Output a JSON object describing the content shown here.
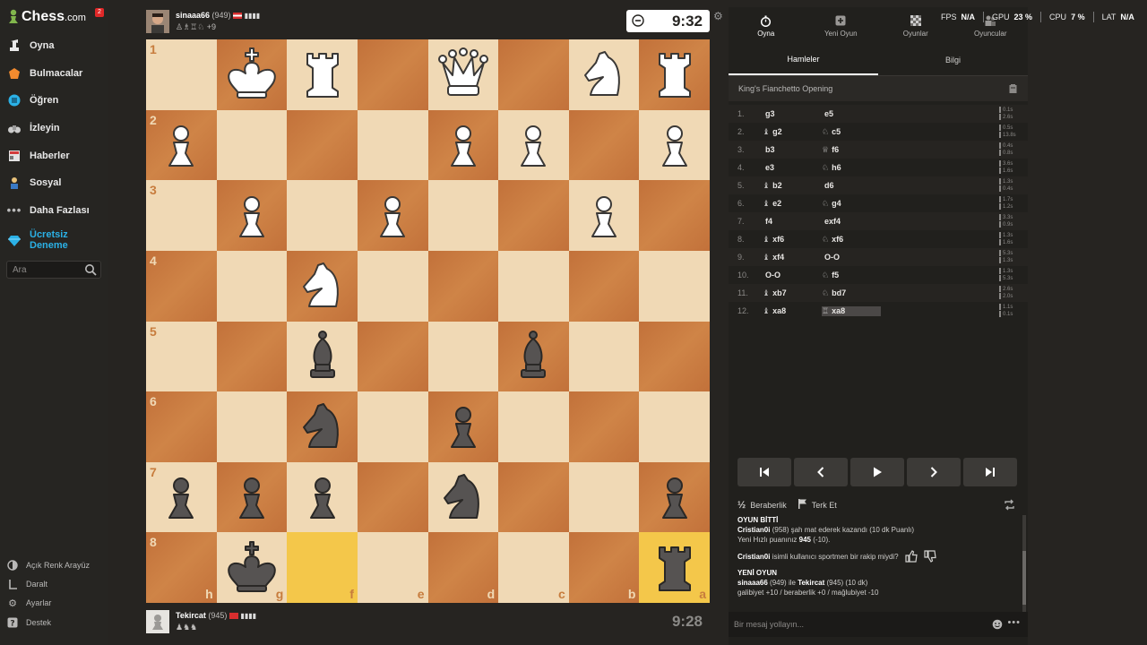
{
  "sidebar": {
    "logo": "Chess",
    "logo_suffix": ".com",
    "notif_count": "2",
    "items": [
      {
        "label": "Oyna"
      },
      {
        "label": "Bulmacalar"
      },
      {
        "label": "Öğren"
      },
      {
        "label": "İzleyin"
      },
      {
        "label": "Haberler"
      },
      {
        "label": "Sosyal"
      },
      {
        "label": "Daha Fazlası"
      }
    ],
    "premium_line1": "Ücretsiz",
    "premium_line2": "Deneme",
    "search_placeholder": "Ara",
    "bottom": [
      {
        "label": "Açık Renk Arayüz"
      },
      {
        "label": "Daralt"
      },
      {
        "label": "Ayarlar"
      },
      {
        "label": "Destek"
      }
    ]
  },
  "top_player": {
    "name": "sinaaa66",
    "rating": "(949)",
    "captured_extra": "+9",
    "clock": "9:32"
  },
  "bottom_player": {
    "name": "Tekircat",
    "rating": "(945)",
    "clock": "9:28"
  },
  "board": {
    "orientation": "black",
    "ranks": [
      "1",
      "2",
      "3",
      "4",
      "5",
      "6",
      "7",
      "8"
    ],
    "files": [
      "h",
      "g",
      "f",
      "e",
      "d",
      "c",
      "b",
      "a"
    ],
    "pieces": {
      "g1": "wK",
      "f1": "wR",
      "d1": "wQ",
      "b1": "wN",
      "a1": "wR",
      "h2": "wP",
      "d2": "wP",
      "c2": "wP",
      "a2": "wP",
      "g3": "wP",
      "e3": "wP",
      "b3": "wP",
      "f4": "wN",
      "f5": "bB",
      "c5": "bB",
      "f6": "bN",
      "d6": "bP",
      "h7": "bP",
      "g7": "bP",
      "f7": "bP",
      "d7": "bN",
      "a7": "bP",
      "g8": "bK",
      "a8": "bR"
    },
    "highlight": [
      "f8",
      "a8"
    ]
  },
  "panel": {
    "tabs": [
      {
        "label": "Oyna",
        "icon": "stopwatch-icon"
      },
      {
        "label": "Yeni Oyun",
        "icon": "plus-icon"
      },
      {
        "label": "Oyunlar",
        "icon": "board-icon"
      },
      {
        "label": "Oyuncular",
        "icon": "players-icon"
      }
    ],
    "sub_tabs": [
      "Hamleler",
      "Bilgi"
    ],
    "opening": "King's Fianchetto Opening",
    "moves": [
      {
        "n": "1.",
        "wg": "",
        "w": "g3",
        "bg": "",
        "b": "e5",
        "t1": "0.1s",
        "t2": "2.6s"
      },
      {
        "n": "2.",
        "wg": "♝",
        "w": "g2",
        "bg": "♘",
        "b": "c5",
        "t1": "0.5s",
        "t2": "13.8s"
      },
      {
        "n": "3.",
        "wg": "",
        "w": "b3",
        "bg": "♕",
        "b": "f6",
        "t1": "0.4s",
        "t2": "0.8s"
      },
      {
        "n": "4.",
        "wg": "",
        "w": "e3",
        "bg": "♘",
        "b": "h6",
        "t1": "3.6s",
        "t2": "1.6s"
      },
      {
        "n": "5.",
        "wg": "♝",
        "w": "b2",
        "bg": "",
        "b": "d6",
        "t1": "1.3s",
        "t2": "0.4s"
      },
      {
        "n": "6.",
        "wg": "♝",
        "w": "e2",
        "bg": "♘",
        "b": "g4",
        "t1": "1.7s",
        "t2": "1.2s"
      },
      {
        "n": "7.",
        "wg": "",
        "w": "f4",
        "bg": "",
        "b": "exf4",
        "t1": "3.3s",
        "t2": "0.9s"
      },
      {
        "n": "8.",
        "wg": "♝",
        "w": "xf6",
        "bg": "♘",
        "b": "xf6",
        "t1": "1.3s",
        "t2": "1.6s"
      },
      {
        "n": "9.",
        "wg": "♝",
        "w": "xf4",
        "bg": "",
        "b": "O-O",
        "t1": "5.3s",
        "t2": "1.3s"
      },
      {
        "n": "10.",
        "wg": "",
        "w": "O-O",
        "bg": "♘",
        "b": "f5",
        "t1": "1.3s",
        "t2": "5.3s"
      },
      {
        "n": "11.",
        "wg": "♝",
        "w": "xb7",
        "bg": "♘",
        "b": "bd7",
        "t1": "2.6s",
        "t2": "2.0s"
      },
      {
        "n": "12.",
        "wg": "♝",
        "w": "xa8",
        "bg": "♖",
        "b": "xa8",
        "t1": "1.1s",
        "t2": "0.1s"
      }
    ],
    "actions": {
      "draw_glyph": "½",
      "draw": "Beraberlik",
      "resign": "Terk Et"
    },
    "chat": {
      "over_title": "OYUN BİTTİ",
      "winner": "Cristian0i",
      "winner_rest": "(958) şah mat ederek kazandı (10 dk Puanlı)",
      "new_rating_prefix": "Yeni Hızlı puanınız",
      "new_rating": "945",
      "new_rating_delta": "(-10).",
      "sport_name": "Cristian0i",
      "sport_rest": "isimli kullanıcı sportmen bir rakip miydi?",
      "new_game_title": "YENİ OYUN",
      "ng_p1": "sinaaa66",
      "ng_p1_rest": "(949) ile",
      "ng_p2": "Tekircat",
      "ng_p2_rest": "(945) (10 dk)",
      "ng_outcomes": "galibiyet +10 / beraberlik +0 / mağlubiyet -10",
      "input_placeholder": "Bir mesaj yollayın..."
    }
  },
  "stats": {
    "fps_label": "FPS",
    "fps": "N/A",
    "gpu_label": "GPU",
    "gpu": "23 %",
    "cpu_label": "CPU",
    "cpu": "7 %",
    "lat_label": "LAT",
    "lat": "N/A"
  }
}
